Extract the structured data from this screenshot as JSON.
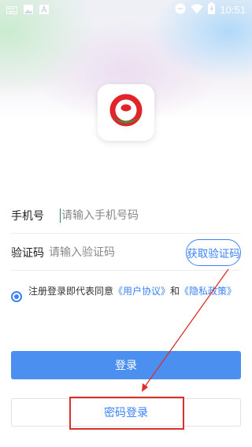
{
  "status_bar": {
    "time": "10:51",
    "left_icons": [
      "keyboard-icon",
      "image-icon",
      "font-icon"
    ],
    "right_icons": [
      "minus-circle-icon",
      "wifi-icon",
      "battery-icon"
    ]
  },
  "app": {
    "logo": "app-logo",
    "accent": "#3b82f6",
    "logo_colors": {
      "red": "#e0242a",
      "green": "#2e9a3e"
    }
  },
  "form": {
    "phone": {
      "label": "手机号",
      "placeholder": "请输入手机号码",
      "value": ""
    },
    "code": {
      "label": "验证码",
      "placeholder": "请输入验证码",
      "value": "",
      "button": "获取验证码"
    }
  },
  "agreement": {
    "checked": true,
    "prefix": "注册登录即代表同意",
    "user_agreement": "《用户协议》",
    "conjunction": "和",
    "privacy_policy": "《隐私政策》"
  },
  "buttons": {
    "login": "登录",
    "password_login": "密码登录"
  },
  "annotation": {
    "color": "#d9302a"
  }
}
